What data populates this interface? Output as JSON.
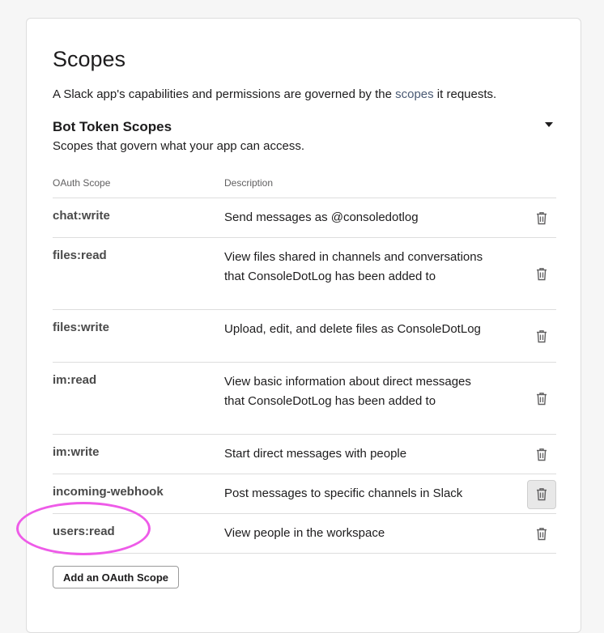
{
  "page": {
    "title": "Scopes",
    "intro_prefix": "A Slack app's capabilities and permissions are governed by the ",
    "intro_link": "scopes",
    "intro_suffix": " it requests."
  },
  "bot_scopes": {
    "title": "Bot Token Scopes",
    "description": "Scopes that govern what your app can access.",
    "expanded_icon": "caret-down-icon",
    "columns": {
      "scope": "OAuth Scope",
      "description": "Description"
    },
    "rows": [
      {
        "scope": "chat:write",
        "description": "Send messages as @consoledotlog"
      },
      {
        "scope": "files:read",
        "description": "View files shared in channels and conversations that ConsoleDotLog has been added to"
      },
      {
        "scope": "files:write",
        "description": "Upload, edit, and delete files as ConsoleDotLog"
      },
      {
        "scope": "im:read",
        "description": "View basic information about direct messages that ConsoleDotLog has been added to"
      },
      {
        "scope": "im:write",
        "description": "Start direct messages with people"
      },
      {
        "scope": "incoming-webhook",
        "description": "Post messages to specific channels in Slack"
      },
      {
        "scope": "users:read",
        "description": "View people in the workspace"
      }
    ],
    "delete_icon": "trash-icon",
    "add_button": "Add an OAuth Scope"
  },
  "colors": {
    "annotation": "#ee5be8",
    "link": "#4a5a74",
    "border": "#dddddd"
  }
}
